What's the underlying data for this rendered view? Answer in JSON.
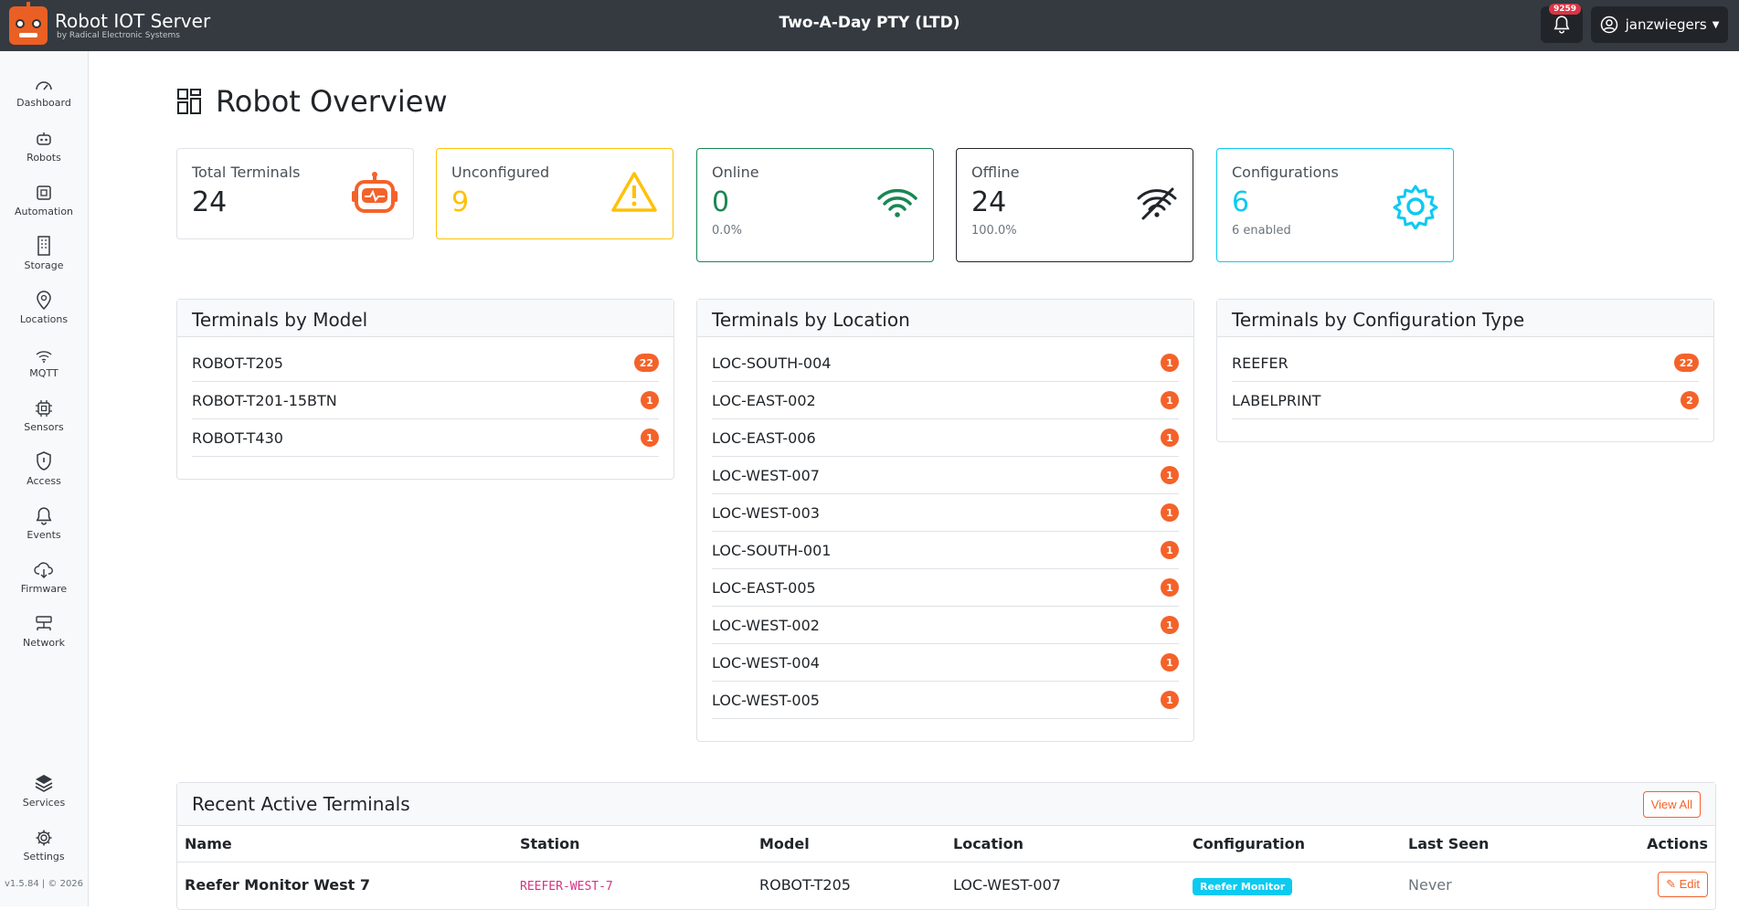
{
  "header": {
    "app_title": "Robot IOT Server",
    "app_subtitle": "by Radical Electronic Systems",
    "org_name": "Two-A-Day PTY (LTD)",
    "notification_count": "9259",
    "username": "janzwiegers"
  },
  "sidebar": {
    "items": [
      {
        "label": "Dashboard",
        "icon": "speedometer-icon"
      },
      {
        "label": "Robots",
        "icon": "robot-icon"
      },
      {
        "label": "Automation",
        "icon": "cpu-icon"
      },
      {
        "label": "Storage",
        "icon": "building-icon"
      },
      {
        "label": "Locations",
        "icon": "map-pin-icon"
      },
      {
        "label": "MQTT",
        "icon": "wifi-icon"
      },
      {
        "label": "Sensors",
        "icon": "chip-icon"
      },
      {
        "label": "Access",
        "icon": "shield-icon"
      },
      {
        "label": "Events",
        "icon": "bell-icon"
      },
      {
        "label": "Firmware",
        "icon": "cloud-download-icon"
      },
      {
        "label": "Network",
        "icon": "network-icon"
      }
    ],
    "bottom_items": [
      {
        "label": "Services",
        "icon": "layers-icon"
      },
      {
        "label": "Settings",
        "icon": "gear-icon"
      }
    ],
    "version": "v1.5.84 | © 2026"
  },
  "page": {
    "title": "Robot Overview"
  },
  "stats": [
    {
      "label": "Total Terminals",
      "value": "24",
      "sub": "",
      "color": "#212529",
      "border": "#dee2e6",
      "icon": "robot-icon"
    },
    {
      "label": "Unconfigured",
      "value": "9",
      "sub": "",
      "color": "#ffc107",
      "border": "#ffc107",
      "icon": "warning-icon"
    },
    {
      "label": "Online",
      "value": "0",
      "sub": "0.0%",
      "color": "#198754",
      "border": "#198754",
      "icon": "wifi-icon"
    },
    {
      "label": "Offline",
      "value": "24",
      "sub": "100.0%",
      "color": "#212529",
      "border": "#212529",
      "icon": "wifi-off-icon"
    },
    {
      "label": "Configurations",
      "value": "6",
      "sub": "6 enabled",
      "color": "#0dcaf0",
      "border": "#0dcaf0",
      "icon": "gear-icon"
    }
  ],
  "by_model": {
    "title": "Terminals by Model",
    "rows": [
      {
        "name": "ROBOT-T205",
        "count": "22"
      },
      {
        "name": "ROBOT-T201-15BTN",
        "count": "1"
      },
      {
        "name": "ROBOT-T430",
        "count": "1"
      }
    ]
  },
  "by_location": {
    "title": "Terminals by Location",
    "rows": [
      {
        "name": "LOC-SOUTH-004",
        "count": "1"
      },
      {
        "name": "LOC-EAST-002",
        "count": "1"
      },
      {
        "name": "LOC-EAST-006",
        "count": "1"
      },
      {
        "name": "LOC-WEST-007",
        "count": "1"
      },
      {
        "name": "LOC-WEST-003",
        "count": "1"
      },
      {
        "name": "LOC-SOUTH-001",
        "count": "1"
      },
      {
        "name": "LOC-EAST-005",
        "count": "1"
      },
      {
        "name": "LOC-WEST-002",
        "count": "1"
      },
      {
        "name": "LOC-WEST-004",
        "count": "1"
      },
      {
        "name": "LOC-WEST-005",
        "count": "1"
      }
    ]
  },
  "by_config": {
    "title": "Terminals by Configuration Type",
    "rows": [
      {
        "name": "REEFER",
        "count": "22"
      },
      {
        "name": "LABELPRINT",
        "count": "2"
      }
    ]
  },
  "recent": {
    "title": "Recent Active Terminals",
    "view_all": "View All",
    "columns": [
      "Name",
      "Station",
      "Model",
      "Location",
      "Configuration",
      "Last Seen",
      "Actions"
    ],
    "rows": [
      {
        "name": "Reefer Monitor West 7",
        "station": "REEFER-WEST-7",
        "model": "ROBOT-T205",
        "location": "LOC-WEST-007",
        "configuration": "Reefer Monitor",
        "last_seen": "Never",
        "action": "Edit"
      }
    ]
  },
  "colors": {
    "accent": "#f4622a",
    "topbar": "#343a40"
  }
}
